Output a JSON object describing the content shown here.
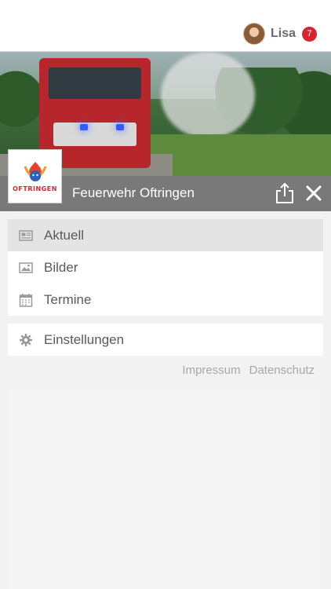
{
  "user": {
    "name": "Lisa",
    "notification_count": "7"
  },
  "organization": {
    "name": "Feuerwehr Oftringen",
    "logo_text": "OFTRINGEN"
  },
  "menu": {
    "items": [
      {
        "label": "Aktuell",
        "icon": "newspaper-icon",
        "active": true
      },
      {
        "label": "Bilder",
        "icon": "image-icon",
        "active": false
      },
      {
        "label": "Termine",
        "icon": "calendar-icon",
        "active": false
      }
    ],
    "settings": {
      "label": "Einstellungen",
      "icon": "gear-icon"
    }
  },
  "footer": {
    "impressum": "Impressum",
    "datenschutz": "Datenschutz"
  },
  "colors": {
    "titlebar": "#797979",
    "badge": "#d9232d",
    "active_item": "#e4e4e4"
  }
}
